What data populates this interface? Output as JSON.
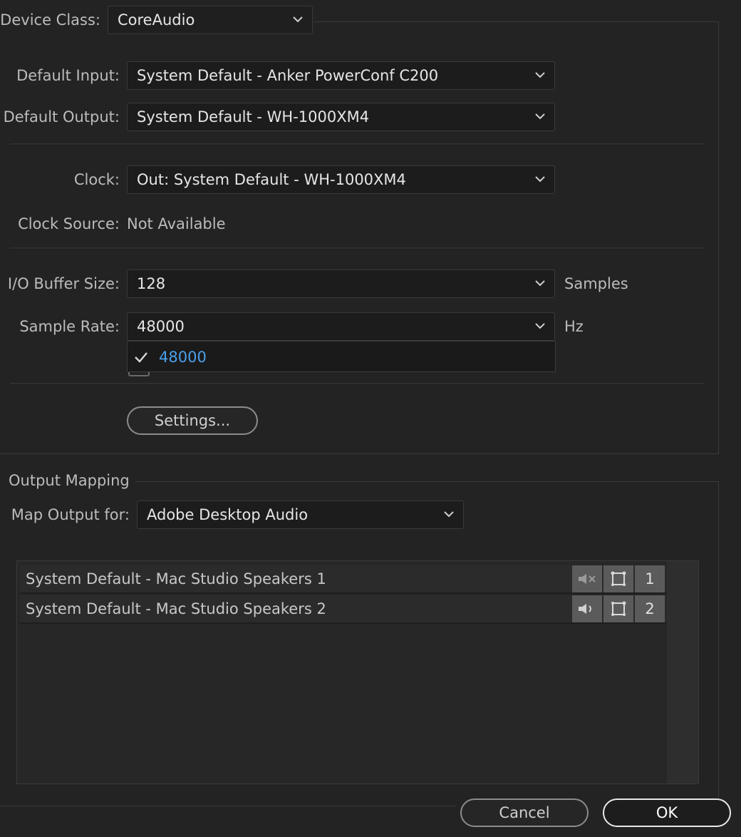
{
  "device_class": {
    "label": "Device Class:",
    "value": "CoreAudio"
  },
  "default_input": {
    "label": "Default Input:",
    "value": "System Default - Anker PowerConf C200"
  },
  "default_output": {
    "label": "Default Output:",
    "value": "System Default - WH-1000XM4"
  },
  "clock": {
    "label": "Clock:",
    "value": "Out: System Default - WH-1000XM4"
  },
  "clock_source": {
    "label": "Clock Source:",
    "value": "Not Available"
  },
  "buffer_size": {
    "label": "I/O Buffer Size:",
    "value": "128",
    "unit": "Samples"
  },
  "sample_rate": {
    "label": "Sample Rate:",
    "value": "48000",
    "unit": "Hz",
    "options": [
      {
        "label": "48000",
        "checked": true
      }
    ]
  },
  "settings_button": "Settings...",
  "output_mapping": {
    "section_title": "Output Mapping",
    "map_label": "Map Output for:",
    "map_value": "Adobe Desktop Audio",
    "rows": [
      {
        "name": "System Default - Mac Studio Speakers 1",
        "channel": "1",
        "speaker_icon": "speaker-muted-icon"
      },
      {
        "name": "System Default - Mac Studio Speakers 2",
        "channel": "2",
        "speaker_icon": "speaker-icon"
      }
    ]
  },
  "footer": {
    "cancel": "Cancel",
    "ok": "OK"
  },
  "colors": {
    "accent": "#4a9fe8",
    "background": "#232323",
    "field": "#1c1c1c"
  }
}
